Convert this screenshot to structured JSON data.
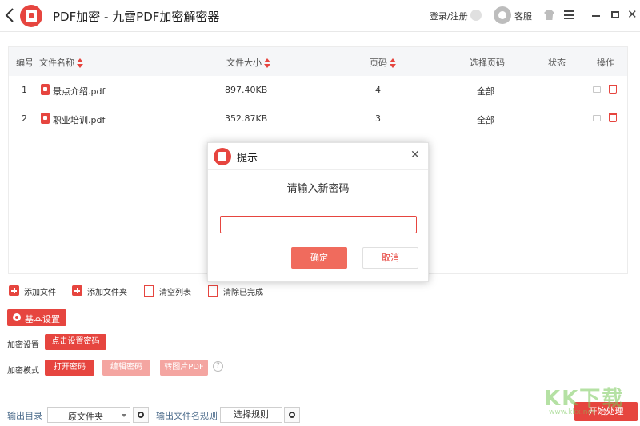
{
  "window": {
    "title": "PDF加密 - 九雷PDF加密解密器",
    "login": "登录/注册",
    "service": "客服"
  },
  "table": {
    "headers": {
      "index": "编号",
      "name": "文件名称",
      "size": "文件大小",
      "pages": "页码",
      "select_pages": "选择页码",
      "status": "状态",
      "actions": "操作"
    },
    "rows": [
      {
        "index": "1",
        "name": "景点介绍.pdf",
        "size": "897.40KB",
        "pages": "4",
        "select_pages": "全部",
        "status": ""
      },
      {
        "index": "2",
        "name": "职业培训.pdf",
        "size": "352.87KB",
        "pages": "3",
        "select_pages": "全部",
        "status": ""
      }
    ]
  },
  "toolbar": {
    "add_file": "添加文件",
    "add_folder": "添加文件夹",
    "clear_list": "清空列表",
    "clear_done": "清除已完成"
  },
  "settings": {
    "basic": "基本设置",
    "encrypt_settings_label": "加密设置",
    "set_password_btn": "点击设置密码",
    "encrypt_mode_label": "加密模式",
    "mode_open": "打开密码",
    "mode_edit": "编辑密码",
    "mode_image": "转图片PDF"
  },
  "output": {
    "dir_label": "输出目录",
    "dir_value": "原文件夹",
    "name_rule_label": "输出文件名规则",
    "rule_btn": "选择规则",
    "start": "开始处理"
  },
  "watermark": {
    "text": "KK下载",
    "sub": "www.kkx.net"
  },
  "dialog": {
    "title": "提示",
    "message": "请输入新密码",
    "input_value": "",
    "ok": "确定",
    "cancel": "取消"
  },
  "colors": {
    "accent": "#e6453f",
    "accent_light": "#f4a5a1"
  }
}
